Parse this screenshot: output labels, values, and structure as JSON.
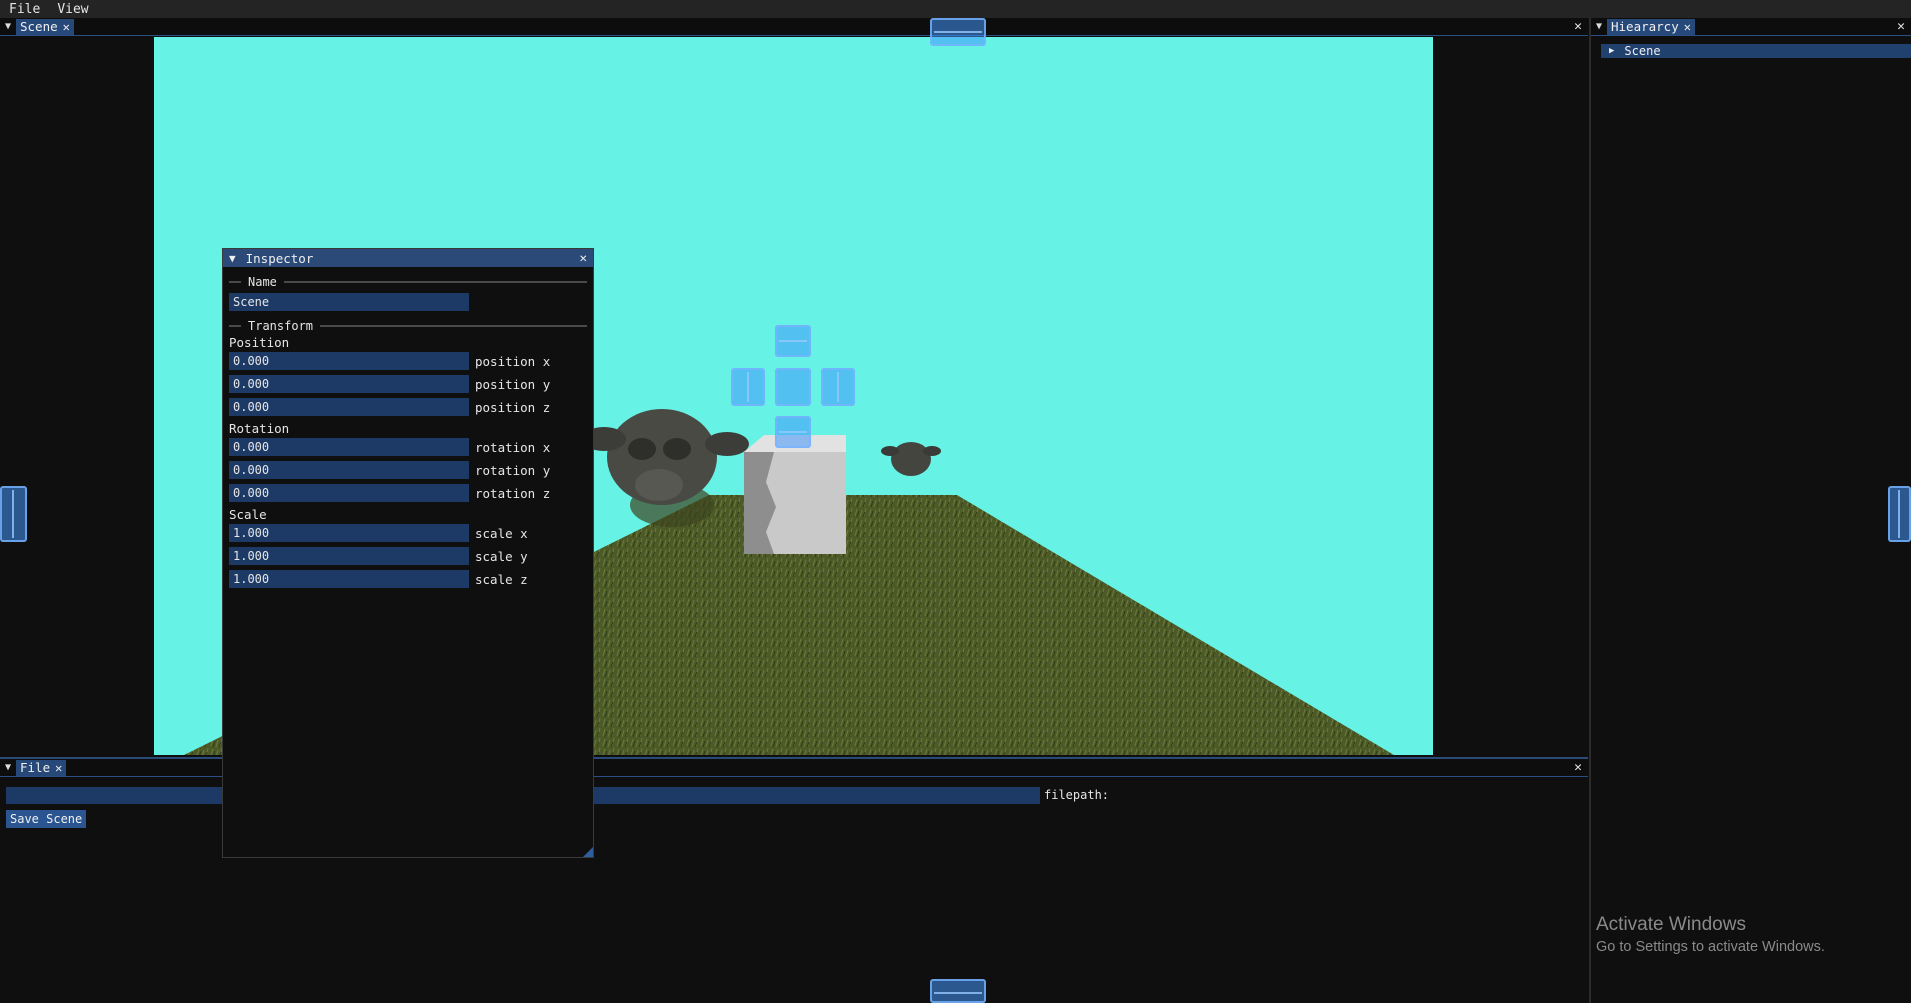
{
  "menu": {
    "items": [
      "File",
      "View"
    ]
  },
  "scene_window": {
    "tab_label": "Scene"
  },
  "hierarchy_window": {
    "tab_label": "Hieararcy",
    "tree": {
      "root": "Scene"
    }
  },
  "file_window": {
    "tab_label": "File",
    "filepath_value": "",
    "filepath_label": "filepath:",
    "save_button": "Save Scene"
  },
  "inspector": {
    "title": "Inspector",
    "name_section": "Name",
    "name_value": "Scene",
    "transform_section": "Transform",
    "position_label": "Position",
    "rotation_label": "Rotation",
    "scale_label": "Scale",
    "fields": {
      "position_x": {
        "value": "0.000",
        "label": "position x"
      },
      "position_y": {
        "value": "0.000",
        "label": "position y"
      },
      "position_z": {
        "value": "0.000",
        "label": "position z"
      },
      "rotation_x": {
        "value": "0.000",
        "label": "rotation x"
      },
      "rotation_y": {
        "value": "0.000",
        "label": "rotation y"
      },
      "rotation_z": {
        "value": "0.000",
        "label": "rotation z"
      },
      "scale_x": {
        "value": "1.000",
        "label": "scale x"
      },
      "scale_y": {
        "value": "1.000",
        "label": "scale y"
      },
      "scale_z": {
        "value": "1.000",
        "label": "scale z"
      }
    }
  },
  "watermark": {
    "line1": "Activate Windows",
    "line2": "Go to Settings to activate Windows."
  },
  "colors": {
    "sky": "#66f3e5",
    "accent": "#26497a",
    "field_bg": "#1d3a66",
    "grass": "#4d5a28"
  }
}
